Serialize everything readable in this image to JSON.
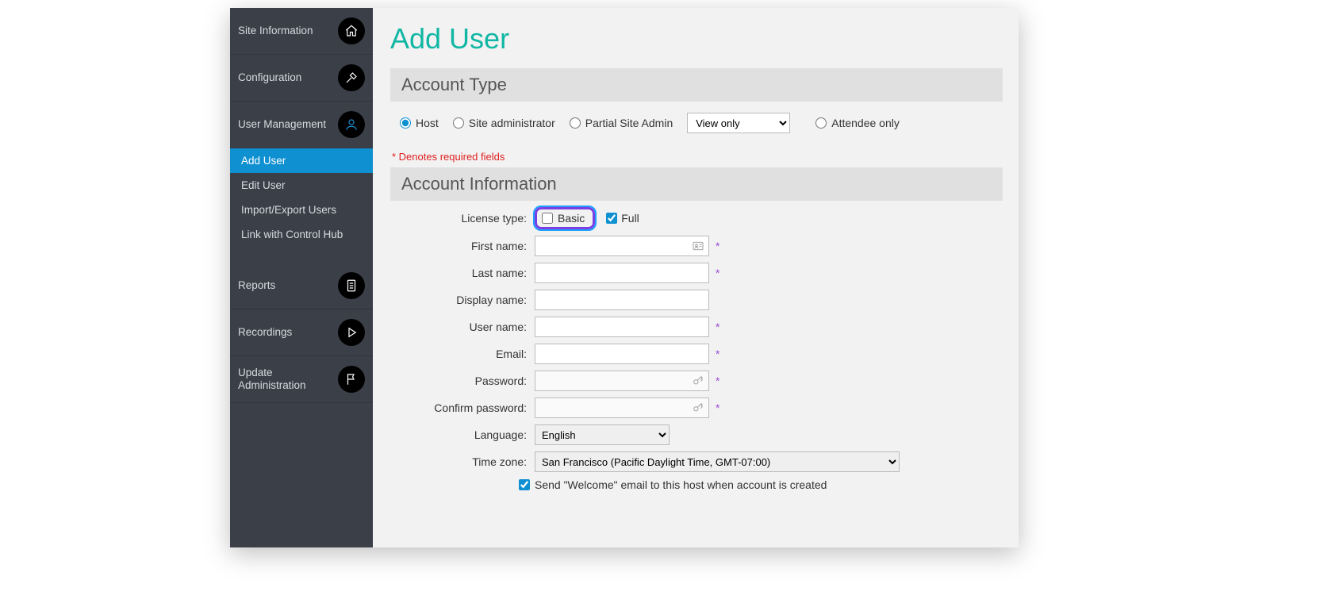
{
  "sidebar": {
    "items": [
      {
        "label": "Site Information",
        "icon": "home"
      },
      {
        "label": "Configuration",
        "icon": "tools"
      },
      {
        "label": "User Management",
        "icon": "user",
        "active": true
      },
      {
        "label": "Reports",
        "icon": "document"
      },
      {
        "label": "Recordings",
        "icon": "play"
      },
      {
        "label": "Update Administration",
        "icon": "flag"
      }
    ],
    "subitems": [
      {
        "label": "Add User",
        "active": true
      },
      {
        "label": "Edit User"
      },
      {
        "label": "Import/Export Users"
      },
      {
        "label": "Link with Control Hub"
      }
    ]
  },
  "page": {
    "title": "Add User",
    "section_account_type": "Account Type",
    "section_account_info": "Account Information",
    "required_note": "* Denotes required fields"
  },
  "account_type": {
    "host": "Host",
    "site_admin": "Site administrator",
    "partial": "Partial Site Admin",
    "partial_select": "View only",
    "attendee": "Attendee only",
    "selected": "host"
  },
  "form": {
    "license_label": "License type:",
    "license_basic": "Basic",
    "license_full": "Full",
    "license_basic_checked": false,
    "license_full_checked": true,
    "first_name": {
      "label": "First name:",
      "value": ""
    },
    "last_name": {
      "label": "Last name:",
      "value": ""
    },
    "display_name": {
      "label": "Display name:",
      "value": ""
    },
    "user_name": {
      "label": "User name:",
      "value": ""
    },
    "email": {
      "label": "Email:",
      "value": ""
    },
    "password": {
      "label": "Password:",
      "value": ""
    },
    "confirm_password": {
      "label": "Confirm password:",
      "value": ""
    },
    "language": {
      "label": "Language:",
      "value": "English"
    },
    "time_zone": {
      "label": "Time zone:",
      "value": "San Francisco (Pacific Daylight Time, GMT-07:00)"
    },
    "welcome_email": {
      "label": "Send \"Welcome\" email to this host when account is created",
      "checked": true
    }
  }
}
